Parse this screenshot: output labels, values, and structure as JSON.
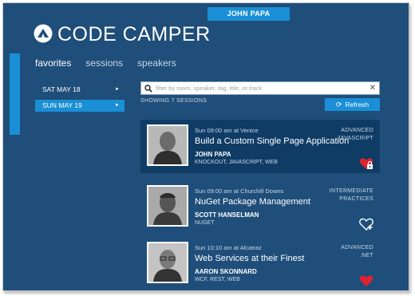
{
  "header": {
    "user": "JOHN PAPA",
    "app_title": "CODE CAMPER"
  },
  "nav": {
    "items": [
      "favorites",
      "sessions",
      "speakers"
    ]
  },
  "days": [
    {
      "label": "SAT MAY 18",
      "arrow": "►"
    },
    {
      "label": "SUN MAY 19",
      "arrow": "►"
    }
  ],
  "search": {
    "placeholder": "filter by room, speaker, tag, title, or track",
    "clear": "✕"
  },
  "session_count": "SHOWING 7 SESSIONS",
  "refresh_label": "Refresh",
  "refresh_icon": "⟳",
  "sessions": [
    {
      "meta": "Sun 09:00 am at Venice",
      "title": "Build a Custom Single Page Application",
      "speaker": "JOHN PAPA",
      "tags": "KNOCKOUT, JAVASCRIPT, WEB",
      "level": "ADVANCED",
      "track": "JAVASCRIPT",
      "icon": "heart-lock-icon"
    },
    {
      "meta": "Sun 09:00 am at Churchill Downs",
      "title": "NuGet Package Management",
      "speaker": "SCOTT HANSELMAN",
      "tags": "NUGET",
      "level": "INTERMEDIATE",
      "track": "PRACTICES",
      "icon": "heart-add-icon"
    },
    {
      "meta": "Sun 10:10 am at Alcatraz",
      "title": "Web Services at their Finest",
      "speaker": "AARON SKONNARD",
      "tags": "WCF, REST, WEB",
      "level": "ADVANCED",
      "track": ".NET",
      "icon": "heart-icon"
    }
  ],
  "colors": {
    "background": "#1f4e7a",
    "accent": "#1a8fd6",
    "highlight": "#0f3c65",
    "heart": "#e0232e"
  }
}
